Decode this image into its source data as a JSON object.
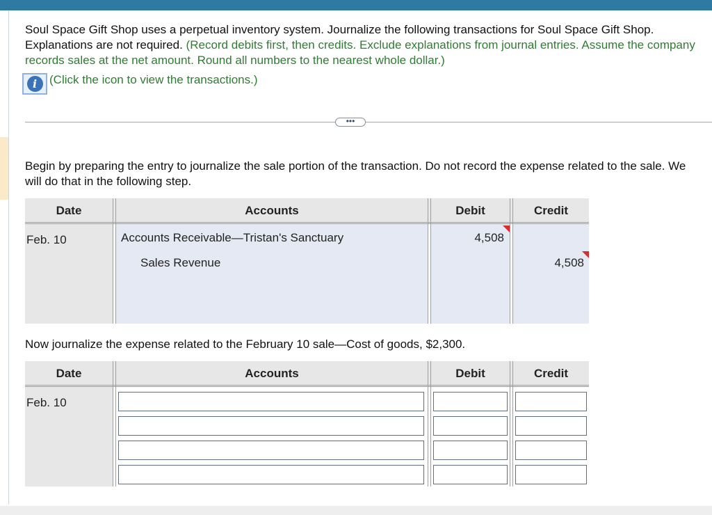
{
  "intro": {
    "main": "Soul Space Gift Shop uses a perpetual inventory system. Journalize the following transactions for Soul Space Gift Shop. Explanations are not required.",
    "instructions": "(Record debits first, then credits. Exclude explanations from journal entries. Assume the company records sales at the net amount. Round all numbers to the nearest whole dollar.)",
    "click_text": "(Click the icon to view the transactions.)"
  },
  "step1": {
    "text": "Begin by preparing the entry to journalize the sale portion of the transaction. Do not record the expense related to the sale. We will do that in the following step."
  },
  "step2": {
    "text": "Now journalize the expense related to the February 10 sale—Cost of goods, $2,300."
  },
  "headers": {
    "date": "Date",
    "accounts": "Accounts",
    "debit": "Debit",
    "credit": "Credit"
  },
  "table1": {
    "date": "Feb. 10",
    "rows": [
      {
        "account": "Accounts Receivable—Tristan's Sanctuary",
        "debit": "4,508",
        "credit": ""
      },
      {
        "account": "Sales Revenue",
        "debit": "",
        "credit": "4,508"
      }
    ]
  },
  "table2": {
    "date": "Feb. 10",
    "rows": [
      {
        "account": "",
        "debit": "",
        "credit": ""
      },
      {
        "account": "",
        "debit": "",
        "credit": ""
      },
      {
        "account": "",
        "debit": "",
        "credit": ""
      },
      {
        "account": "",
        "debit": "",
        "credit": ""
      }
    ]
  },
  "colors": {
    "topbar": "#2f7aa2",
    "instruction_green": "#2e7d32",
    "info_icon": "#3b73b9",
    "row_fill": "#e5e9f3",
    "header_fill": "#e7e7e7",
    "indicator_red": "#d32f2f"
  },
  "icons": {
    "info": "info-icon",
    "more": "ellipsis-icon"
  },
  "more_button": "•••"
}
